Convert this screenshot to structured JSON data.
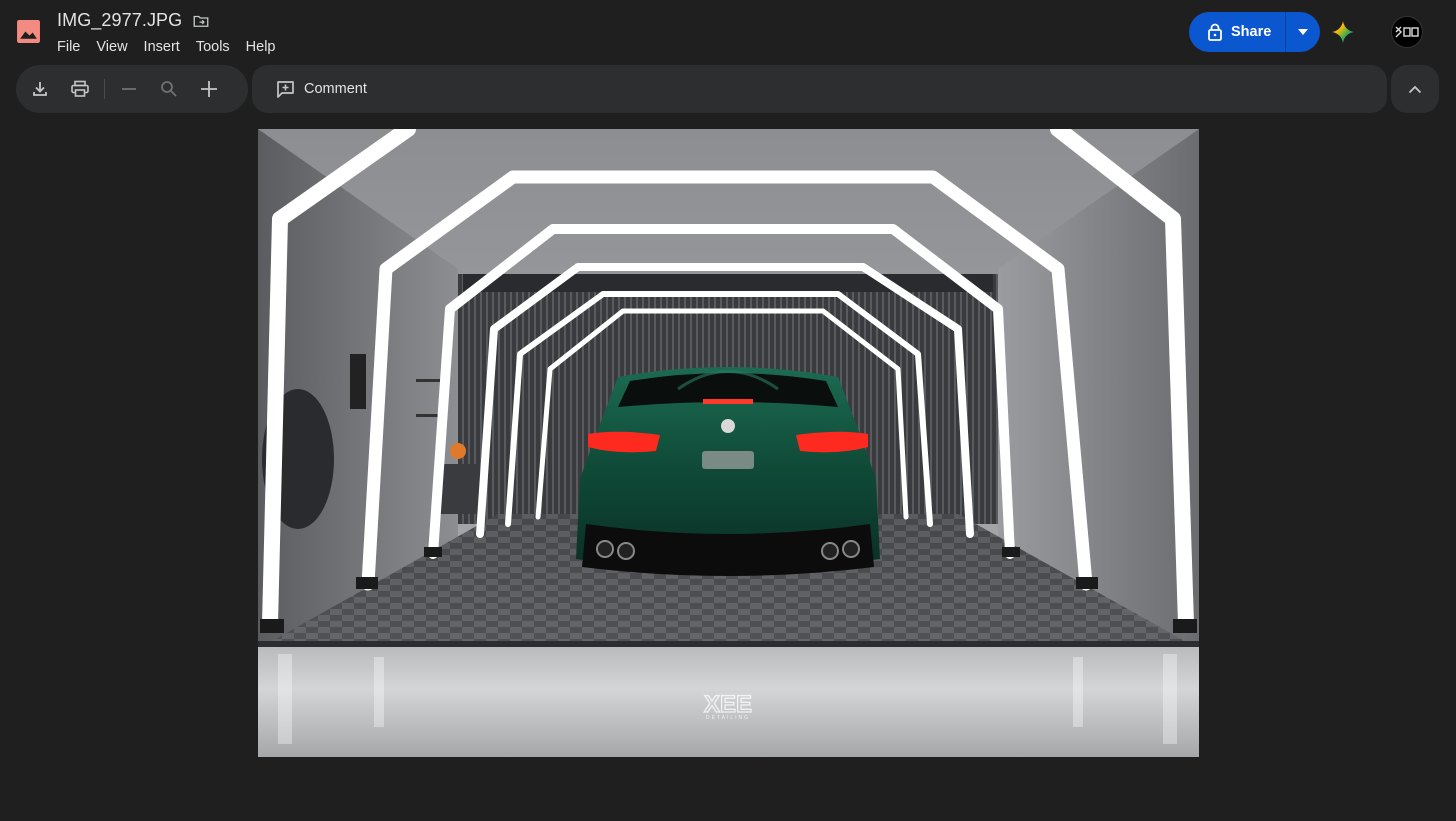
{
  "app": {
    "icon": "image-file-icon",
    "icon_color": "#f28b82",
    "file_title": "IMG_2977.JPG",
    "move_icon": "move-to-folder-icon"
  },
  "menu": {
    "items": [
      {
        "label": "File"
      },
      {
        "label": "View"
      },
      {
        "label": "Insert"
      },
      {
        "label": "Tools"
      },
      {
        "label": "Help"
      }
    ]
  },
  "share": {
    "label": "Share",
    "icon": "lock-icon",
    "dropdown_icon": "caret-down-icon",
    "color": "#0b57d0"
  },
  "gemini": {
    "icon": "gemini-sparkle-icon"
  },
  "avatar": {
    "icon": "account-avatar"
  },
  "toolbar": {
    "download_icon": "download-icon",
    "print_icon": "print-icon",
    "zoom_out_icon": "minus-icon",
    "zoom_icon": "magnifier-icon",
    "zoom_in_icon": "plus-icon"
  },
  "comment": {
    "label": "Comment",
    "icon": "add-comment-icon"
  },
  "collapse": {
    "icon": "chevron-up-icon"
  },
  "image": {
    "subject": "green sports sedan rear view inside lit detailing tunnel",
    "car_color": "#0f4a37",
    "watermark_brand": "XEE",
    "watermark_sub": "DETAILING"
  }
}
